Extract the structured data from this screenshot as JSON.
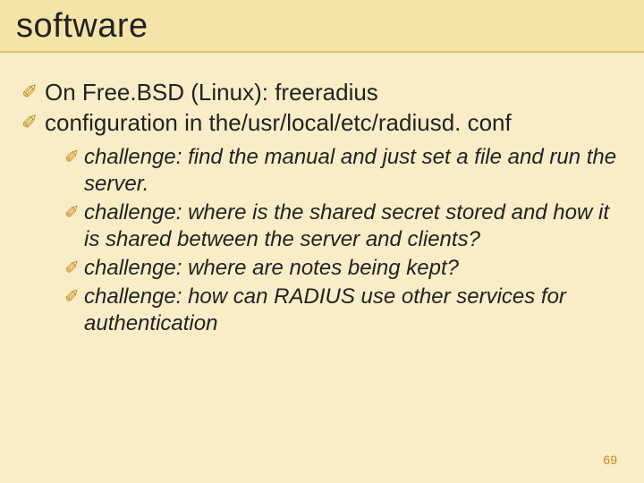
{
  "title": "software",
  "bullets": [
    {
      "text": "On Free.BSD (Linux): freeradius"
    },
    {
      "text": "configuration in the/usr/local/etc/radiusd. conf",
      "children": [
        {
          "text": "challenge: find the manual and just set a file and run the server."
        },
        {
          "text": "challenge: where is the shared secret stored and how it is shared between the server and clients?"
        },
        {
          "text": "challenge: where are notes being kept?"
        },
        {
          "text": "challenge: how can RADIUS use other services for authentication"
        }
      ]
    }
  ],
  "page_number": "69",
  "glyphs": {
    "level1": "✐",
    "level2": "✐"
  }
}
